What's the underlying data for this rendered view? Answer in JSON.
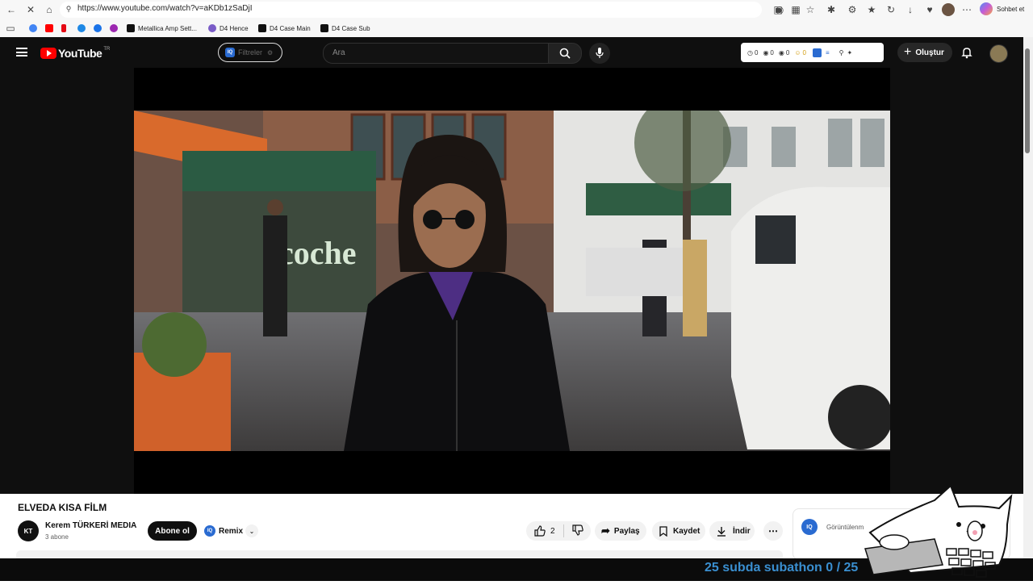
{
  "browser": {
    "url": "https://www.youtube.com/watch?v=aKDb1zSaDjI",
    "chat_label": "Sohbet et",
    "bookmarks": [
      {
        "label": "",
        "color": "#4285f4"
      },
      {
        "label": "",
        "color": "#ff0000"
      },
      {
        "label": "",
        "color": "#e50914"
      },
      {
        "label": "",
        "color": "#1e88e5"
      },
      {
        "label": "",
        "color": "#1a73e8"
      },
      {
        "label": "",
        "color": "#9c27b0"
      },
      {
        "label": "Metallica Amp Sett...",
        "color": "#111111"
      },
      {
        "label": "D4 Hence",
        "color": "#7a5cc7"
      },
      {
        "label": "D4 Case Main",
        "color": "#111111"
      },
      {
        "label": "D4 Case Sub",
        "color": "#111111"
      }
    ]
  },
  "youtube": {
    "logo_text": "YouTube",
    "region": "TR",
    "filters_label": "Filtreler",
    "search_placeholder": "Ara",
    "ext_counts": [
      "0",
      "0",
      "0",
      "0"
    ],
    "create_label": "Oluştur",
    "video": {
      "sign_text": "coche"
    },
    "title": "ELVEDA KISA FİLM",
    "channel": {
      "name": "Kerem TÜRKERİ MEDIA",
      "subscribers": "3 abone",
      "subscribe_label": "Abone ol",
      "remix_label": "Remix"
    },
    "actions": {
      "likes": "2",
      "share": "Paylaş",
      "save": "Kaydet",
      "download": "İndir"
    },
    "side_panel": {
      "label": "Görüntülenm"
    }
  },
  "overlay": {
    "subathon": "25 subda subathon 0 / 25"
  },
  "colors": {
    "yt_bg": "#0f0f0f",
    "yt_red": "#ff0000",
    "subathon_blue": "#3a8fd0"
  }
}
